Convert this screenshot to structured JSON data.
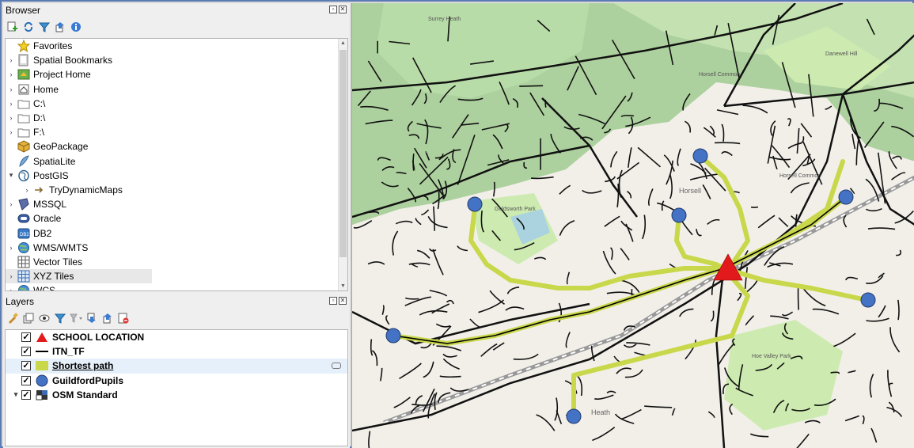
{
  "browser": {
    "title": "Browser",
    "toolbar_icons": [
      "add-icon",
      "refresh-icon",
      "filter-icon",
      "collapse-icon",
      "info-icon"
    ],
    "items": [
      {
        "label": "Favorites",
        "icon": "star-icon",
        "indent": 0,
        "arrow": "none"
      },
      {
        "label": "Spatial Bookmarks",
        "icon": "bookmark-icon",
        "indent": 0,
        "arrow": "collapsed"
      },
      {
        "label": "Project Home",
        "icon": "project-home-icon",
        "indent": 0,
        "arrow": "collapsed"
      },
      {
        "label": "Home",
        "icon": "home-icon",
        "indent": 0,
        "arrow": "collapsed"
      },
      {
        "label": "C:\\",
        "icon": "folder-icon",
        "indent": 0,
        "arrow": "collapsed"
      },
      {
        "label": "D:\\",
        "icon": "folder-icon",
        "indent": 0,
        "arrow": "collapsed"
      },
      {
        "label": "F:\\",
        "icon": "folder-icon",
        "indent": 0,
        "arrow": "collapsed"
      },
      {
        "label": "GeoPackage",
        "icon": "geopackage-icon",
        "indent": 0,
        "arrow": "none"
      },
      {
        "label": "SpatiaLite",
        "icon": "spatialite-icon",
        "indent": 0,
        "arrow": "none"
      },
      {
        "label": "PostGIS",
        "icon": "postgis-icon",
        "indent": 0,
        "arrow": "expanded"
      },
      {
        "label": "TryDynamicMaps",
        "icon": "connection-icon",
        "indent": 1,
        "arrow": "collapsed"
      },
      {
        "label": "MSSQL",
        "icon": "mssql-icon",
        "indent": 0,
        "arrow": "collapsed"
      },
      {
        "label": "Oracle",
        "icon": "oracle-icon",
        "indent": 0,
        "arrow": "none"
      },
      {
        "label": "DB2",
        "icon": "db2-icon",
        "indent": 0,
        "arrow": "none"
      },
      {
        "label": "WMS/WMTS",
        "icon": "globe-icon",
        "indent": 0,
        "arrow": "collapsed"
      },
      {
        "label": "Vector Tiles",
        "icon": "grid-icon",
        "indent": 0,
        "arrow": "none"
      },
      {
        "label": "XYZ Tiles",
        "icon": "xyz-grid-icon",
        "indent": 0,
        "arrow": "collapsed",
        "selected": true
      },
      {
        "label": "WCS",
        "icon": "globe-icon",
        "indent": 0,
        "arrow": "collapsed"
      }
    ]
  },
  "layers": {
    "title": "Layers",
    "toolbar_icons": [
      "style-icon",
      "add-group-icon",
      "visibility-icon",
      "filter-icon",
      "filter-legend-icon",
      "expand-icon",
      "collapse-icon",
      "remove-icon"
    ],
    "items": [
      {
        "label": "SCHOOL LOCATION",
        "symbol": "red-triangle",
        "checked": true,
        "expander": false
      },
      {
        "label": "ITN_TF",
        "symbol": "black-line",
        "checked": true,
        "expander": false
      },
      {
        "label": "Shortest path",
        "symbol": "green-fill",
        "checked": true,
        "expander": false,
        "selected": true
      },
      {
        "label": "GuildfordPupils",
        "symbol": "blue-circle",
        "checked": true,
        "expander": false
      },
      {
        "label": "OSM Standard",
        "symbol": "raster-icon",
        "checked": true,
        "expander": true
      }
    ]
  },
  "map": {
    "labels": {
      "pond": "Surrey Heath",
      "horsell_common": "Horsell Common",
      "horsell": "Horsell",
      "goldsworth_park": "Goldsworth Park",
      "heath": "Heath",
      "danewell_hill": "Danewell Hill",
      "horsell_common_2": "Horsell Common",
      "hoe_valley_park": "Hoe Valley Park"
    },
    "colors": {
      "path": "#c8d84a",
      "pupil": "#4472c4",
      "school": "#e31a1c",
      "road": "#111111",
      "wood": "#add19e",
      "grass": "#cdebb0"
    }
  }
}
